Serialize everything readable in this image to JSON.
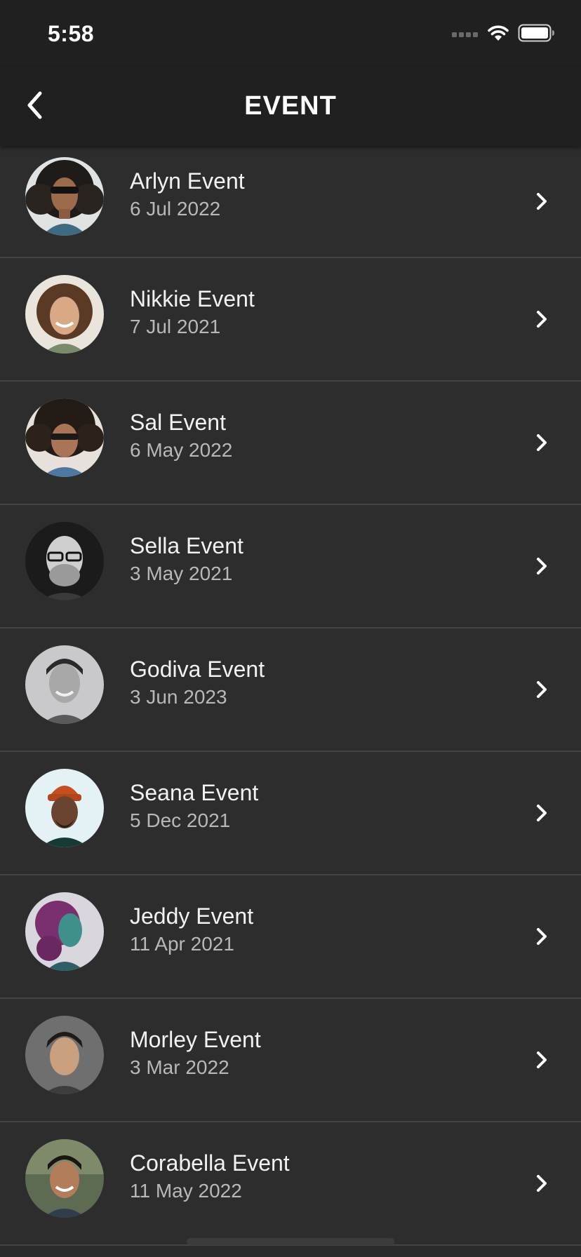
{
  "status_bar": {
    "time": "5:58",
    "icons": [
      "cellular-dots-icon",
      "wifi-icon",
      "battery-icon"
    ]
  },
  "nav": {
    "back_icon": "chevron-left-icon",
    "title": "EVENT"
  },
  "colors": {
    "background": "#2d2d2d",
    "bar": "#202020",
    "divider": "#444444",
    "primary_text": "#f2f2f2",
    "secondary_text": "#b8b8b8"
  },
  "events": [
    {
      "name": "Arlyn Event",
      "date": "6 Jul 2022",
      "avatar": "person-sunglasses-curly-hair"
    },
    {
      "name": "Nikkie Event",
      "date": "7 Jul 2021",
      "avatar": "person-smiling-curly-hair"
    },
    {
      "name": "Sal Event",
      "date": "6 May 2022",
      "avatar": "person-afro-sunglasses"
    },
    {
      "name": "Sella Event",
      "date": "3 May 2021",
      "avatar": "person-glasses-beard-bw"
    },
    {
      "name": "Godiva Event",
      "date": "3 Jun 2023",
      "avatar": "person-smiling-bw"
    },
    {
      "name": "Seana Event",
      "date": "5 Dec 2021",
      "avatar": "person-orange-beanie"
    },
    {
      "name": "Jeddy Event",
      "date": "11 Apr 2021",
      "avatar": "person-purple-hair-profile"
    },
    {
      "name": "Morley Event",
      "date": "3 Mar 2022",
      "avatar": "person-portrait-gray"
    },
    {
      "name": "Corabella Event",
      "date": "11 May 2022",
      "avatar": "person-smiling-outdoor"
    }
  ]
}
